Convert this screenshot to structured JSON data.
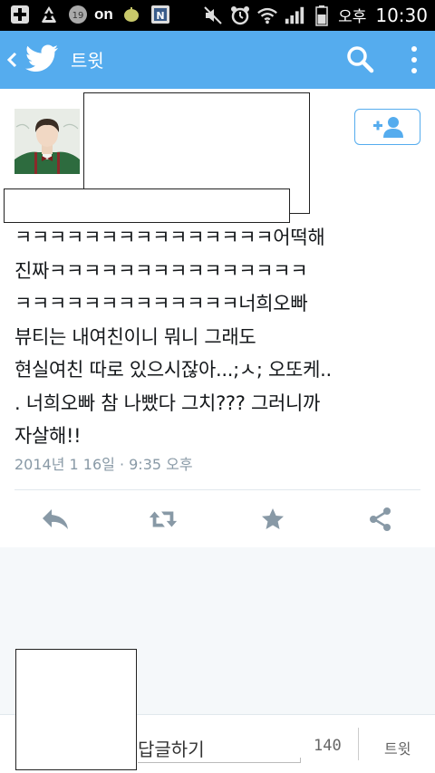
{
  "status_bar": {
    "on_label": "on",
    "notification_count": "19",
    "n_badge": "N",
    "ampm": "오후",
    "time": "10:30"
  },
  "toolbar": {
    "title": "트윗",
    "color": "#55acee"
  },
  "tweet": {
    "lines": [
      "ㅋㅋㅋㅋㅋㅋㅋㅋㅋㅋㅋㅋㅋㅋㅋ어떡해",
      "진짜ㅋㅋㅋㅋㅋㅋㅋㅋㅋㅋㅋㅋㅋㅋㅋ",
      "ㅋㅋㅋㅋㅋㅋㅋㅋㅋㅋㅋㅋㅋ너희오빠",
      "뷰티는 내여친이니 뭐니 그래도",
      "현실여친 따로 있으시잖아...;ㅅ; 오또케..",
      ". 너희오빠 참 나빴다 그치??? 그러니까",
      "자살해!!"
    ],
    "timestamp": "2014년 1 16일 · 9:35 오후"
  },
  "actions": {
    "icons": [
      "reply-icon",
      "retweet-icon",
      "favorite-icon",
      "share-icon"
    ],
    "icon_color": "#8899a6"
  },
  "reply_bar": {
    "placeholder": "답글하기",
    "char_count": "140",
    "send_label": "트윗"
  }
}
